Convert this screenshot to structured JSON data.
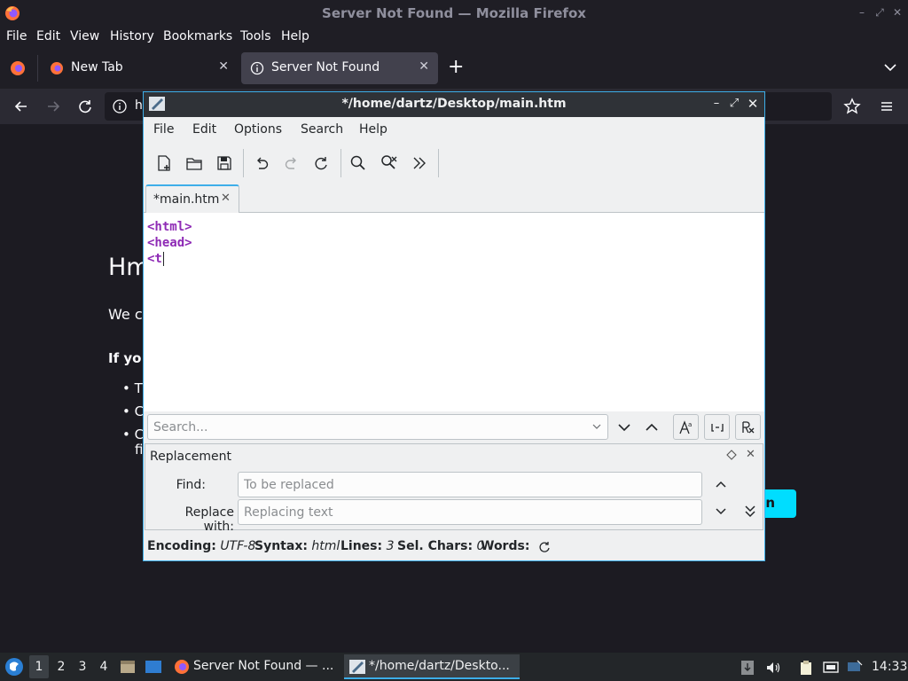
{
  "firefox": {
    "window_title": "Server Not Found — Mozilla Firefox",
    "menu": [
      "File",
      "Edit",
      "View",
      "History",
      "Bookmarks",
      "Tools",
      "Help"
    ],
    "menu_underline": [
      "F",
      "E",
      "V",
      "H",
      "B",
      "T",
      "H"
    ],
    "tabs": [
      {
        "label": "New Tab",
        "active": false
      },
      {
        "label": "Server Not Found",
        "active": true
      }
    ],
    "url_fragment": "h",
    "page": {
      "heading_fragment": "Hm",
      "para_fragment": "We c",
      "bold_fragment": "If yo",
      "list_fragments": [
        "T",
        "C",
        "C",
        "fi"
      ],
      "button_fragment": "n"
    }
  },
  "editor": {
    "window_title": "*/home/dartz/Desktop/main.htm",
    "menu": [
      "File",
      "Edit",
      "Options",
      "Search",
      "Help"
    ],
    "tab_label": "*main.htm",
    "lines": [
      "<html>",
      "<head>",
      "<t"
    ],
    "search": {
      "placeholder": "Search..."
    },
    "replace": {
      "header": "Replacement",
      "find_label": "Find:",
      "find_placeholder": "To be replaced",
      "replace_label": "Replace with:",
      "replace_placeholder": "Replacing text"
    },
    "status": {
      "encoding_label": "Encoding:",
      "encoding": "UTF-8",
      "syntax_label": "Syntax:",
      "syntax": "html",
      "lines_label": "Lines:",
      "lines": "3",
      "selchars_label": "Sel. Chars:",
      "selchars": "0",
      "words_label": "Words:"
    }
  },
  "taskbar": {
    "workspaces": [
      "1",
      "2",
      "3",
      "4"
    ],
    "current_workspace": "1",
    "tasks": [
      {
        "label": "Server Not Found — ...",
        "active": false
      },
      {
        "label": "*/home/dartz/Deskto...",
        "active": true
      }
    ],
    "clock": "14:33"
  },
  "colors": {
    "accent": "#3daee9",
    "firefox_dark": "#1c1b22",
    "tag_purple": "#8e2ab5",
    "cyan_button": "#00ddff"
  }
}
